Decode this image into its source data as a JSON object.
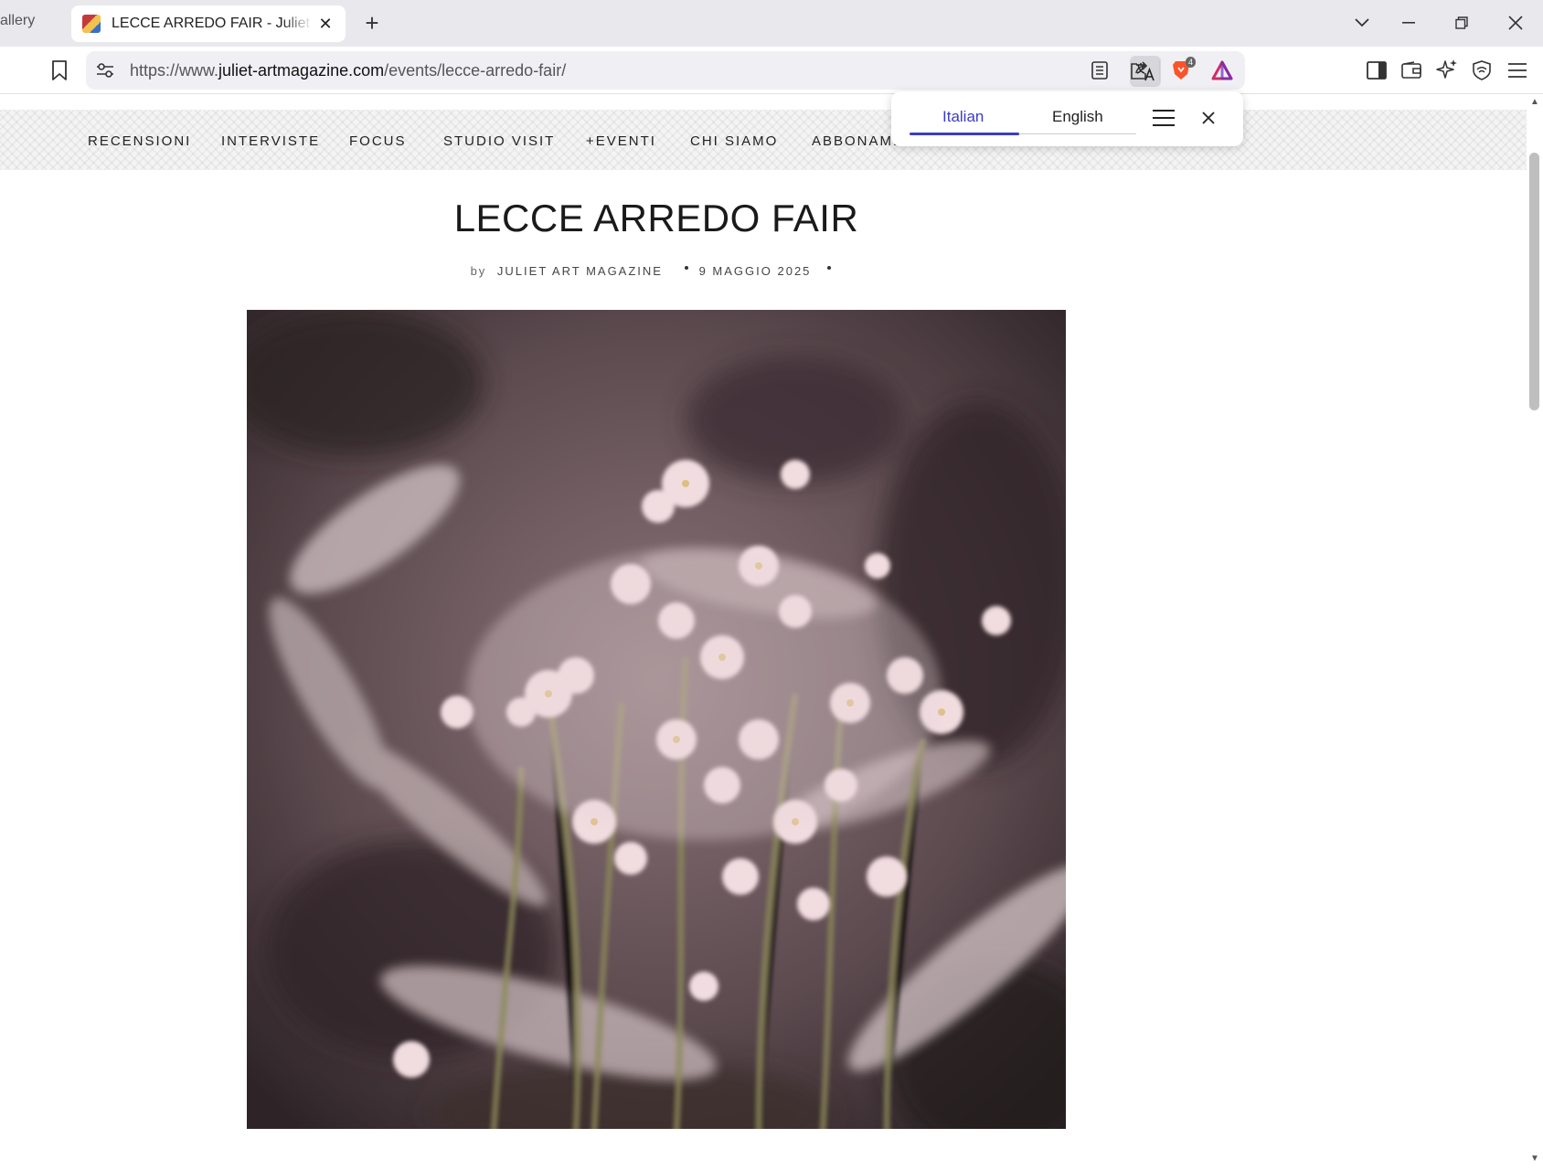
{
  "browser": {
    "prev_tab_label": "allery",
    "active_tab_title": "LECCE ARREDO FAIR - Juliet Art Magazine",
    "url_prefix": "https://www.",
    "url_domain": "juliet-artmagazine.com",
    "url_path": "/events/lecce-arredo-fair/",
    "shield_badge": "4"
  },
  "translate_popup": {
    "source_language": "Italian",
    "target_language": "English"
  },
  "site_nav": {
    "items": [
      "RECENSIONI",
      "INTERVISTE",
      "FOCUS",
      "STUDIO VISIT",
      "+EVENTI",
      "CHI SIAMO",
      "ABBONAMENTI"
    ]
  },
  "article": {
    "title": "LECCE ARREDO FAIR",
    "by_label": "by",
    "author": "JULIET ART MAGAZINE",
    "date": "9 MAGGIO 2025"
  },
  "colors": {
    "accent": "#3c3cc4",
    "brave_orange": "#fb542b"
  }
}
